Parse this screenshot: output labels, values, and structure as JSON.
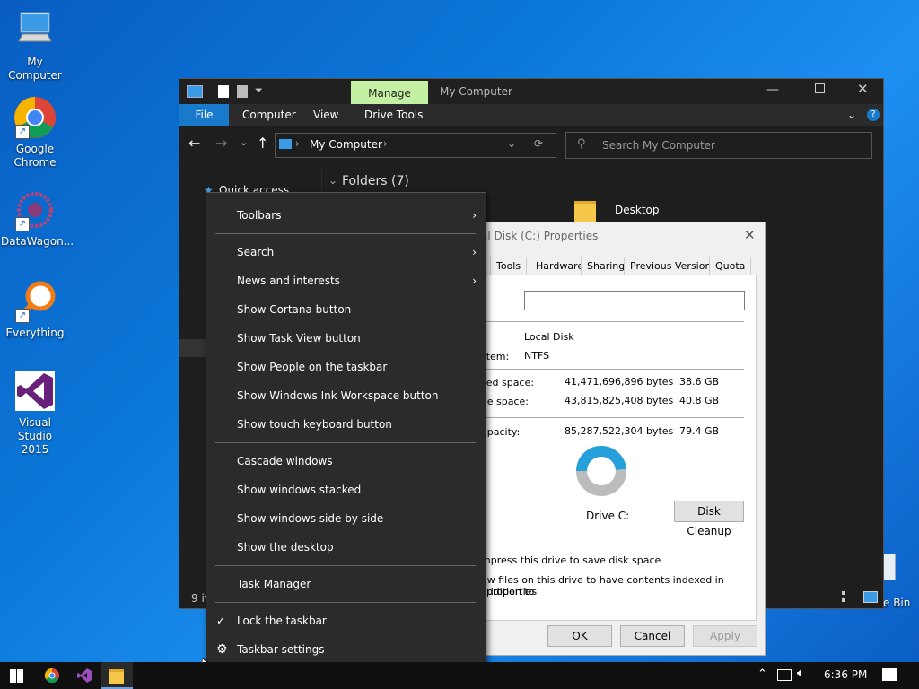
{
  "desktop": {
    "icons": [
      {
        "label": "My Computer"
      },
      {
        "label": "Google\nChrome"
      },
      {
        "label": "DataWagon..."
      },
      {
        "label": "Everything"
      },
      {
        "label": "Visual Studio\n2015"
      }
    ],
    "recycle_bin_label_partial": "e Bin"
  },
  "explorer": {
    "title": "My Computer",
    "manage_tab": "Manage",
    "ribbon_tabs": [
      "File",
      "Computer",
      "View",
      "Drive Tools"
    ],
    "address_path": "My Computer",
    "search_placeholder": "Search My Computer",
    "quick_access": "Quick access",
    "folders_header": "Folders (7)",
    "folder_desktop": "Desktop",
    "status_items_partial": "9 it"
  },
  "properties": {
    "title_partial": "al Disk (C:) Properties",
    "tabs": [
      "Tools",
      "Hardware",
      "Sharing",
      "Previous Versions",
      "Quota"
    ],
    "type_value": "Local Disk",
    "filesystem_label_partial": "stem:",
    "filesystem_value": "NTFS",
    "used_label_partial": "sed space:",
    "used_bytes": "41,471,696,896 bytes",
    "used_gb": "38.6 GB",
    "free_label_partial": "ee space:",
    "free_bytes": "43,815,825,408 bytes",
    "free_gb": "40.8 GB",
    "capacity_label_partial": "apacity:",
    "capacity_bytes": "85,287,522,304 bytes",
    "capacity_gb": "79.4 GB",
    "drive_label": "Drive C:",
    "disk_cleanup": "Disk Cleanup",
    "compress_partial": "mpress this drive to save disk space",
    "index_partial_1": "ow files on this drive to have contents indexed in addition to",
    "index_partial_2": "properties",
    "ok": "OK",
    "cancel": "Cancel",
    "apply": "Apply",
    "used_fraction": 0.486,
    "colors": {
      "used": "#26a0da",
      "free": "#bcbcbc"
    }
  },
  "context_menu": {
    "items": [
      {
        "label": "Toolbars",
        "submenu": true
      },
      {
        "label": "Search",
        "submenu": true
      },
      {
        "label": "News and interests",
        "submenu": true
      },
      {
        "label": "Show Cortana button"
      },
      {
        "label": "Show Task View button"
      },
      {
        "label": "Show People on the taskbar"
      },
      {
        "label": "Show Windows Ink Workspace button"
      },
      {
        "label": "Show touch keyboard button"
      },
      {
        "label": "Cascade windows"
      },
      {
        "label": "Show windows stacked"
      },
      {
        "label": "Show windows side by side"
      },
      {
        "label": "Show the desktop"
      },
      {
        "label": "Task Manager"
      },
      {
        "label": "Lock the taskbar",
        "checked": true
      },
      {
        "label": "Taskbar settings",
        "icon": "gear-icon"
      }
    ]
  },
  "taskbar": {
    "time": "6:36 PM"
  }
}
